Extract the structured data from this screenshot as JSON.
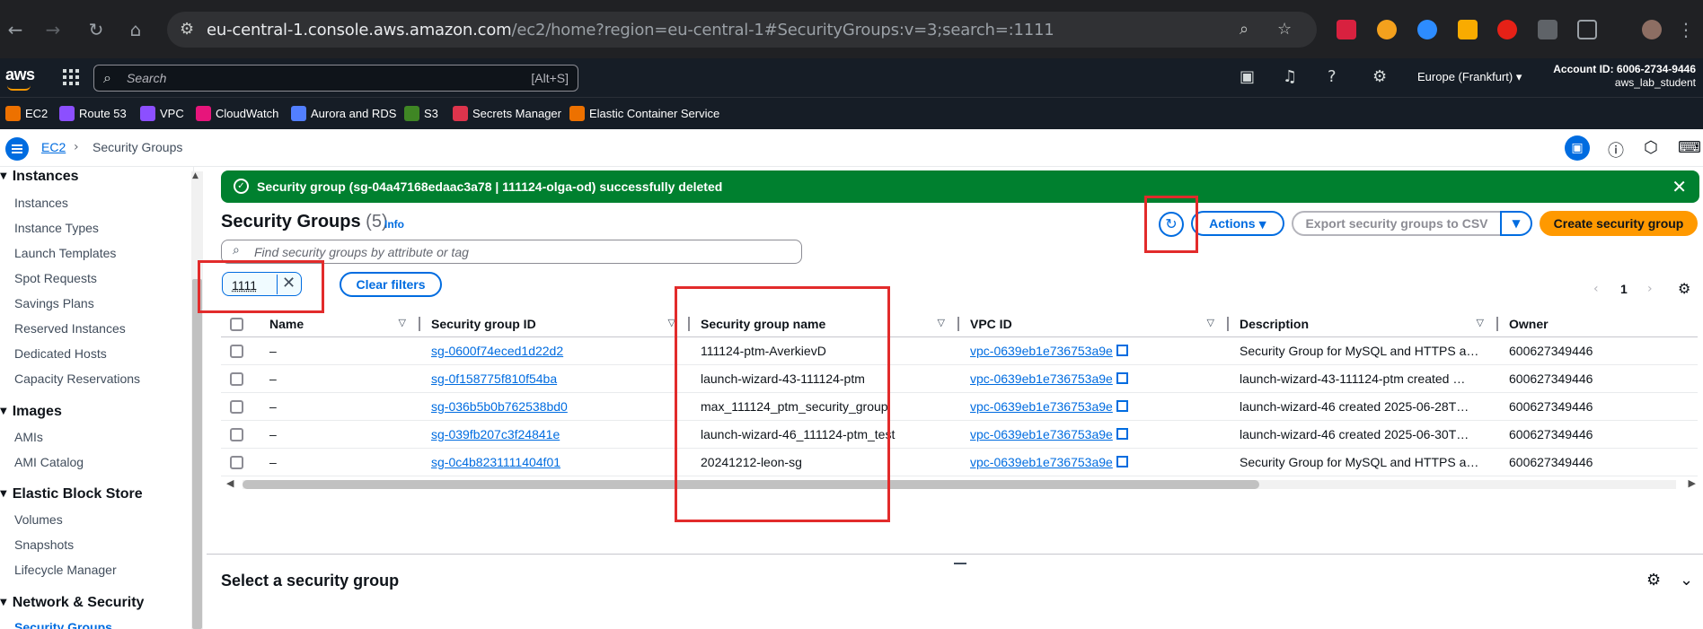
{
  "browser": {
    "url_host": "eu-central-1.console.aws.amazon.com",
    "url_path": "/ec2/home?region=eu-central-1#SecurityGroups:v=3;search=:1111"
  },
  "console": {
    "search_placeholder": "Search",
    "search_shortcut": "[Alt+S]",
    "region": "Europe (Frankfurt)",
    "account_id": "Account ID: 6006-2734-9446",
    "username": "aws_lab_student"
  },
  "favorites": [
    {
      "label": "EC2",
      "color": "#ed7100"
    },
    {
      "label": "Route 53",
      "color": "#8c4fff"
    },
    {
      "label": "VPC",
      "color": "#8c4fff"
    },
    {
      "label": "CloudWatch",
      "color": "#e7157b"
    },
    {
      "label": "Aurora and RDS",
      "color": "#527fff"
    },
    {
      "label": "S3",
      "color": "#3f8624"
    },
    {
      "label": "Secrets Manager",
      "color": "#dd344c"
    },
    {
      "label": "Elastic Container Service",
      "color": "#ed7100"
    }
  ],
  "breadcrumb": {
    "root": "EC2",
    "current": "Security Groups"
  },
  "sidebar": {
    "sections": [
      {
        "title": "Instances",
        "items": [
          "Instances",
          "Instance Types",
          "Launch Templates",
          "Spot Requests",
          "Savings Plans",
          "Reserved Instances",
          "Dedicated Hosts",
          "Capacity Reservations"
        ]
      },
      {
        "title": "Images",
        "items": [
          "AMIs",
          "AMI Catalog"
        ]
      },
      {
        "title": "Elastic Block Store",
        "items": [
          "Volumes",
          "Snapshots",
          "Lifecycle Manager"
        ]
      },
      {
        "title": "Network & Security",
        "items": [
          "Security Groups"
        ]
      }
    ]
  },
  "flash": {
    "message": "Security group (sg-04a47168edaac3a78 | 111124-olga-od) successfully deleted"
  },
  "page": {
    "title": "Security Groups",
    "count": "(5)",
    "info": "Info",
    "actions": "Actions",
    "export": "Export security groups to CSV",
    "create": "Create security group",
    "filter_placeholder": "Find security groups by attribute or tag",
    "token": "1111",
    "clear_filters": "Clear filters",
    "page_number": "1"
  },
  "table": {
    "columns": [
      "Name",
      "Security group ID",
      "Security group name",
      "VPC ID",
      "Description",
      "Owner"
    ],
    "rows": [
      {
        "name": "–",
        "id": "sg-0600f74eced1d22d2",
        "group_name": "111124-ptm-AverkievD",
        "vpc": "vpc-0639eb1e736753a9e",
        "description": "Security Group for MySQL and HTTPS a…",
        "owner": "600627349446"
      },
      {
        "name": "–",
        "id": "sg-0f158775f810f54ba",
        "group_name": "launch-wizard-43-111124-ptm",
        "vpc": "vpc-0639eb1e736753a9e",
        "description": "launch-wizard-43-111124-ptm created …",
        "owner": "600627349446"
      },
      {
        "name": "–",
        "id": "sg-036b5b0b762538bd0",
        "group_name": "max_111124_ptm_security_group",
        "vpc": "vpc-0639eb1e736753a9e",
        "description": "launch-wizard-46 created 2025-06-28T…",
        "owner": "600627349446"
      },
      {
        "name": "–",
        "id": "sg-039fb207c3f24841e",
        "group_name": "launch-wizard-46_111124-ptm_test",
        "vpc": "vpc-0639eb1e736753a9e",
        "description": "launch-wizard-46 created 2025-06-30T…",
        "owner": "600627349446"
      },
      {
        "name": "–",
        "id": "sg-0c4b8231111404f01",
        "group_name": "20241212-leon-sg",
        "vpc": "vpc-0639eb1e736753a9e",
        "description": "Security Group for MySQL and HTTPS a…",
        "owner": "600627349446"
      }
    ]
  },
  "details": {
    "title": "Select a security group"
  }
}
